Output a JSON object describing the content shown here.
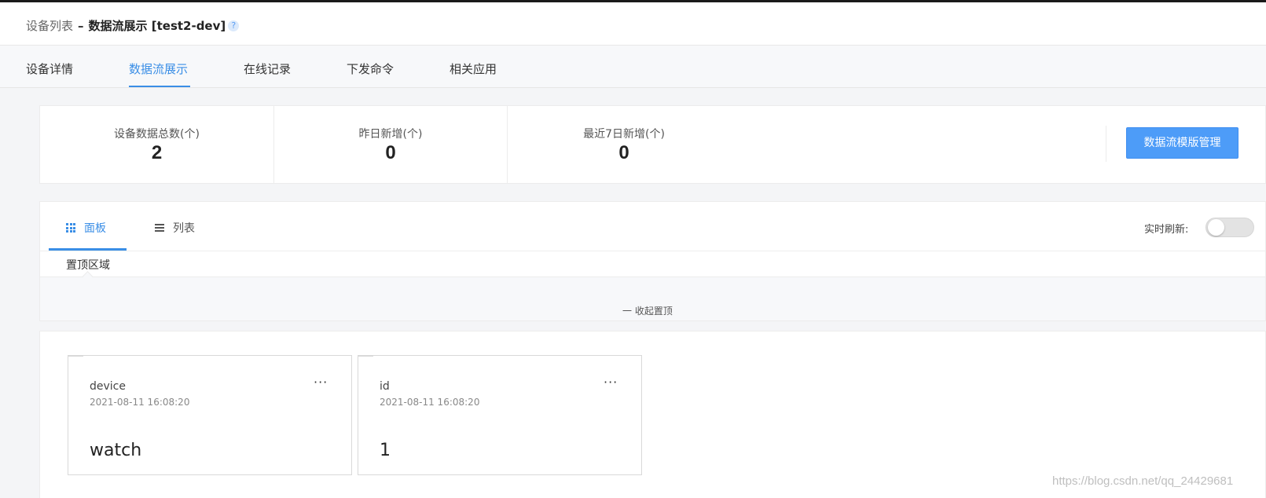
{
  "breadcrumb": {
    "parent": "设备列表",
    "separator": "–",
    "current": "数据流展示 [test2-dev]",
    "help": "?"
  },
  "tabs": [
    {
      "label": "设备详情",
      "active": false
    },
    {
      "label": "数据流展示",
      "active": true
    },
    {
      "label": "在线记录",
      "active": false
    },
    {
      "label": "下发命令",
      "active": false
    },
    {
      "label": "相关应用",
      "active": false
    }
  ],
  "stats": [
    {
      "label": "设备数据总数(个)",
      "value": "2"
    },
    {
      "label": "昨日新增(个)",
      "value": "0"
    },
    {
      "label": "最近7日新增(个)",
      "value": "0"
    }
  ],
  "template_button": "数据流模版管理",
  "view_tabs": [
    {
      "label": "面板",
      "icon": "grid-icon",
      "active": true
    },
    {
      "label": "列表",
      "icon": "list-icon",
      "active": false
    }
  ],
  "realtime_refresh": {
    "label": "实时刷新:",
    "enabled": false
  },
  "pinned": {
    "label": "置顶区域",
    "collapse": "一 收起置顶"
  },
  "cards": [
    {
      "name": "device",
      "time": "2021-08-11 16:08:20",
      "value": "watch",
      "menu": "···"
    },
    {
      "name": "id",
      "time": "2021-08-11 16:08:20",
      "value": "1",
      "menu": "···"
    }
  ],
  "watermark": "https://blog.csdn.net/qq_24429681",
  "colors": {
    "accent": "#3a8ee6",
    "button": "#4d9cf8"
  }
}
